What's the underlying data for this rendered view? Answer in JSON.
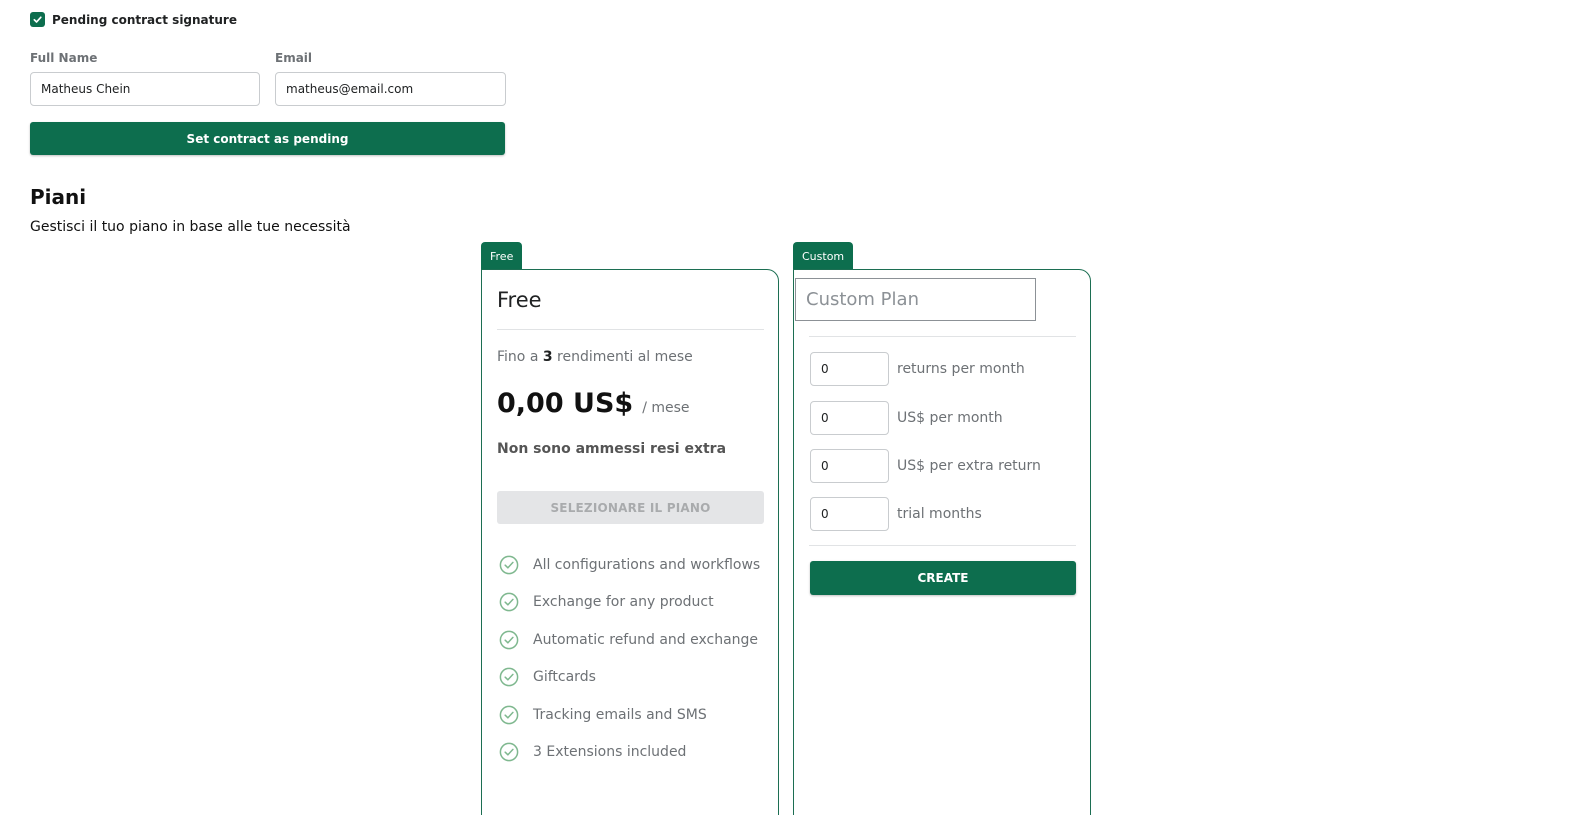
{
  "contract": {
    "pending_label": "Pending contract signature",
    "pending_checked": true,
    "full_name_label": "Full Name",
    "full_name_value": "Matheus Chein",
    "email_label": "Email",
    "email_value": "matheus@email.com",
    "set_pending_button": "Set contract as pending"
  },
  "plans": {
    "title": "Piani",
    "subtitle": "Gestisci il tuo piano in base alle tue necessità",
    "free": {
      "badge": "Free",
      "name": "Free",
      "limit_prefix": "Fino a ",
      "limit_count": "3",
      "limit_suffix": " rendimenti al mese",
      "price": "0,00 US$",
      "period": "/ mese",
      "extra_note": "Non sono ammessi resi extra",
      "select_button": "SELEZIONARE IL PIANO",
      "features": [
        "All configurations and workflows",
        "Exchange for any product",
        "Automatic refund and exchange",
        "Giftcards",
        "Tracking emails and SMS",
        "3 Extensions included"
      ]
    },
    "custom": {
      "badge": "Custom",
      "name_placeholder": "Custom Plan",
      "returns_value": "0",
      "returns_label": "returns per month",
      "price_value": "0",
      "price_label": "US$ per month",
      "extra_value": "0",
      "extra_label": "US$ per extra return",
      "trial_value": "0",
      "trial_label": "trial months",
      "create_button": "CREATE"
    }
  },
  "colors": {
    "accent": "#0d6e4e",
    "check_icon": "#7fb88f"
  }
}
